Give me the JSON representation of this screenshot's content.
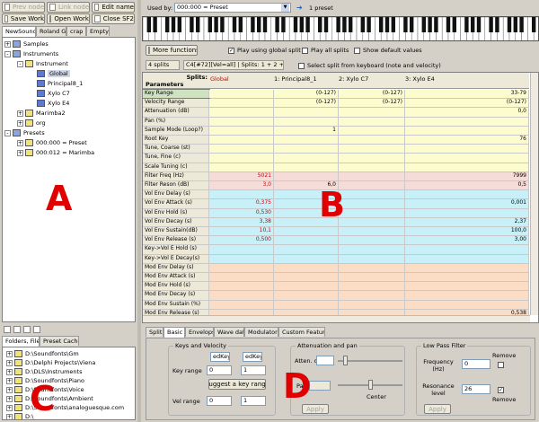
{
  "toolbar": {
    "prev_node": "Prev node",
    "link_node": "Link node",
    "edit_name": "Edit name",
    "save_work": "Save Work",
    "open_work": "Open Work",
    "close_sf2": "Close SF2"
  },
  "left_tabs": [
    "NewSound",
    "Roland G",
    "crap",
    "Empty"
  ],
  "tree": {
    "samples": "Samples",
    "instruments": "Instruments",
    "instrument": "Instrument",
    "global": "Global",
    "principal": "Principal8_1",
    "xylo_c7": "Xylo C7",
    "xylo_e4": "Xylo E4",
    "marimba2": "Marimba2",
    "org": "org",
    "presets": "Presets",
    "preset0": "000:000 = Preset",
    "preset12": "000:012 = Marimba"
  },
  "file_tabs": [
    "Folders, Files",
    "Preset Cache"
  ],
  "folders": [
    "D:\\Soundfonts\\Gm",
    "D:\\Delphi Projects\\Viena",
    "D:\\DLS\\Instruments",
    "D:\\Soundfonts\\Piano",
    "D:\\Soundfonts\\Voice",
    "D:\\Soundfonts\\Ambient",
    "D:\\Soundfonts\\analoguesque.com",
    "D:\\"
  ],
  "used_by": {
    "label": "Used by:",
    "value": "000:000 = Preset",
    "count": "1 preset"
  },
  "options": {
    "more_functions": "More functions ...",
    "play_global": "Play using global split",
    "play_all": "Play all splits",
    "show_defaults": "Show default values"
  },
  "split_info": {
    "count": "4 splits",
    "current": "C4[#72][Vel=all] | Splits: 1 + 2 + 3]",
    "select_kb": "Select split from keyboard (note and velocity)"
  },
  "grid": {
    "params_header": "Parameters",
    "splits_header": "Splits:",
    "columns": [
      "Global",
      "1: Principal8_1",
      "2: Xylo C7",
      "3: Xylo E4"
    ],
    "rows": [
      {
        "name": "Key Range",
        "v": [
          "",
          "(0-127)",
          "(0-127)",
          "33-79"
        ]
      },
      {
        "name": "Velocity Range",
        "v": [
          "",
          "(0-127)",
          "(0-127)",
          "(0-127)"
        ]
      },
      {
        "name": "Attenuation (dB)",
        "v": [
          "",
          "",
          "",
          "0,0"
        ]
      },
      {
        "name": "Pan (%)",
        "v": [
          "",
          "",
          "",
          ""
        ]
      },
      {
        "name": "Sample Mode (Loop?)",
        "v": [
          "",
          "1",
          "",
          ""
        ]
      },
      {
        "name": "Root Key",
        "v": [
          "",
          "",
          "",
          "76"
        ]
      },
      {
        "name": "Tune, Coarse (st)",
        "v": [
          "",
          "",
          "",
          ""
        ]
      },
      {
        "name": "Tune, Fine (c)",
        "v": [
          "",
          "",
          "",
          ""
        ]
      },
      {
        "name": "Scale Tuning (c)",
        "v": [
          "",
          "",
          "",
          ""
        ]
      },
      {
        "name": "Filter Freq (Hz)",
        "v": [
          "5021",
          "",
          "",
          "7999"
        ]
      },
      {
        "name": "Filter Reson (dB)",
        "v": [
          "3,0",
          "6,0",
          "",
          "0,5"
        ]
      },
      {
        "name": "Vol Env Delay (s)",
        "v": [
          "",
          "",
          "",
          ""
        ]
      },
      {
        "name": "Vol Env Attack (s)",
        "v": [
          "0,375",
          "",
          "",
          "0,001"
        ]
      },
      {
        "name": "Vol Env Hold (s)",
        "v": [
          "0,530",
          "",
          "",
          ""
        ]
      },
      {
        "name": "Vol Env Decay (s)",
        "v": [
          "3,38",
          "",
          "",
          "2,37"
        ]
      },
      {
        "name": "Vol Env Sustain(dB)",
        "v": [
          "10,1",
          "",
          "",
          "100,0"
        ]
      },
      {
        "name": "Vol Env Release (s)",
        "v": [
          "0,500",
          "",
          "",
          "3,00"
        ]
      },
      {
        "name": "Key->Vol E Hold (s)",
        "v": [
          "",
          "",
          "",
          ""
        ]
      },
      {
        "name": "Key->Vol E Decay(s)",
        "v": [
          "",
          "",
          "",
          ""
        ]
      },
      {
        "name": "Mod Env Delay (s)",
        "v": [
          "",
          "",
          "",
          ""
        ]
      },
      {
        "name": "Mod Env Attack (s)",
        "v": [
          "",
          "",
          "",
          ""
        ]
      },
      {
        "name": "Mod Env Hold (s)",
        "v": [
          "",
          "",
          "",
          ""
        ]
      },
      {
        "name": "Mod Env Decay (s)",
        "v": [
          "",
          "",
          "",
          ""
        ]
      },
      {
        "name": "Mod Env Sustain (%)",
        "v": [
          "",
          "",
          "",
          ""
        ]
      },
      {
        "name": "Mod Env Release (s)",
        "v": [
          "",
          "",
          "",
          "0,538"
        ]
      }
    ]
  },
  "bottom_tabs": [
    "Split",
    "Basic",
    "Envelops",
    "Wave data",
    "Modulators",
    "Custom Features"
  ],
  "keys_velocity": {
    "title": "Keys and Velocity",
    "edkey": "edKey",
    "key_range": "Key range",
    "key_lo": "0",
    "key_hi": "1",
    "suggest": "Suggest a key range",
    "vel_range": "Vel range",
    "vel_lo": "0",
    "vel_hi": "1"
  },
  "atten_pan": {
    "title": "Attenuation and pan",
    "atten": "Atten. dB",
    "pan": "Pan",
    "center": "Center",
    "apply": "Apply"
  },
  "lpf": {
    "title": "Low Pass Filter",
    "frequency": "Frequency (Hz)",
    "freq_value": "0",
    "remove": "Remove",
    "resonance": "Resonance level",
    "res_value": "26",
    "apply": "Apply"
  },
  "annotations": {
    "a": "A",
    "b": "B",
    "c": "C",
    "d": "D"
  },
  "colors": {
    "yellow": "#fdfccf",
    "pink": "#f6dcd8",
    "cyan": "#c8f0f8",
    "peach": "#fbdcc4",
    "accent_red": "#e00000"
  }
}
